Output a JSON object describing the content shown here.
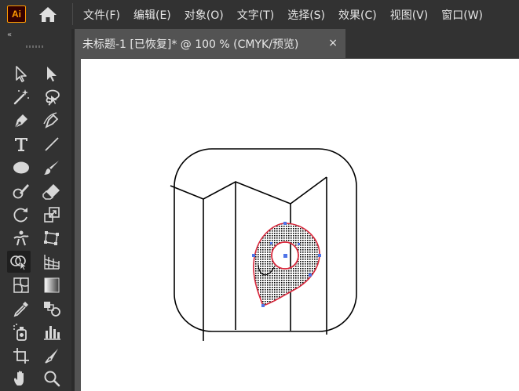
{
  "app": {
    "logo_text": "Ai"
  },
  "menu": {
    "items": [
      "文件(F)",
      "编辑(E)",
      "对象(O)",
      "文字(T)",
      "选择(S)",
      "效果(C)",
      "视图(V)",
      "窗口(W)"
    ]
  },
  "toolbar": {
    "collapse_label": "«",
    "tools": [
      {
        "name": "selection-tool",
        "icon": "arrow-outline-icon"
      },
      {
        "name": "direct-selection-tool",
        "icon": "arrow-filled-icon"
      },
      {
        "name": "magic-wand-tool",
        "icon": "magic-wand-icon"
      },
      {
        "name": "lasso-tool",
        "icon": "lasso-icon"
      },
      {
        "name": "pen-tool",
        "icon": "pen-icon"
      },
      {
        "name": "curvature-tool",
        "icon": "curvature-icon"
      },
      {
        "name": "type-tool",
        "icon": "type-icon"
      },
      {
        "name": "line-segment-tool",
        "icon": "line-icon"
      },
      {
        "name": "ellipse-tool",
        "icon": "ellipse-icon"
      },
      {
        "name": "paintbrush-tool",
        "icon": "brush-icon"
      },
      {
        "name": "shaper-tool",
        "icon": "shaper-icon"
      },
      {
        "name": "eraser-tool",
        "icon": "eraser-icon"
      },
      {
        "name": "rotate-tool",
        "icon": "rotate-icon"
      },
      {
        "name": "scale-tool",
        "icon": "scale-icon"
      },
      {
        "name": "puppet-warp-tool",
        "icon": "puppet-icon"
      },
      {
        "name": "free-transform-tool",
        "icon": "free-transform-icon"
      },
      {
        "name": "shape-builder-tool",
        "icon": "shape-builder-icon",
        "active": true
      },
      {
        "name": "perspective-grid-tool",
        "icon": "perspective-icon"
      },
      {
        "name": "mesh-tool",
        "icon": "mesh-icon"
      },
      {
        "name": "gradient-tool",
        "icon": "gradient-icon"
      },
      {
        "name": "eyedropper-tool",
        "icon": "eyedropper-icon"
      },
      {
        "name": "blend-tool",
        "icon": "blend-icon"
      },
      {
        "name": "symbol-sprayer-tool",
        "icon": "symbol-sprayer-icon"
      },
      {
        "name": "column-graph-tool",
        "icon": "column-graph-icon"
      },
      {
        "name": "artboard-tool",
        "icon": "artboard-icon"
      },
      {
        "name": "slice-tool",
        "icon": "slice-icon"
      },
      {
        "name": "hand-tool",
        "icon": "hand-icon"
      },
      {
        "name": "zoom-tool",
        "icon": "zoom-icon"
      }
    ]
  },
  "document": {
    "tab_title": "未标题-1 [已恢复]* @ 100 % (CMYK/预览)",
    "close_label": "×"
  },
  "colors": {
    "ui_dark": "#323232",
    "tab_bg": "#535353",
    "canvas": "#ffffff",
    "logo_orange": "#ff9a00",
    "selection_red": "#d9283c",
    "anchor_blue": "#4f74e8"
  }
}
